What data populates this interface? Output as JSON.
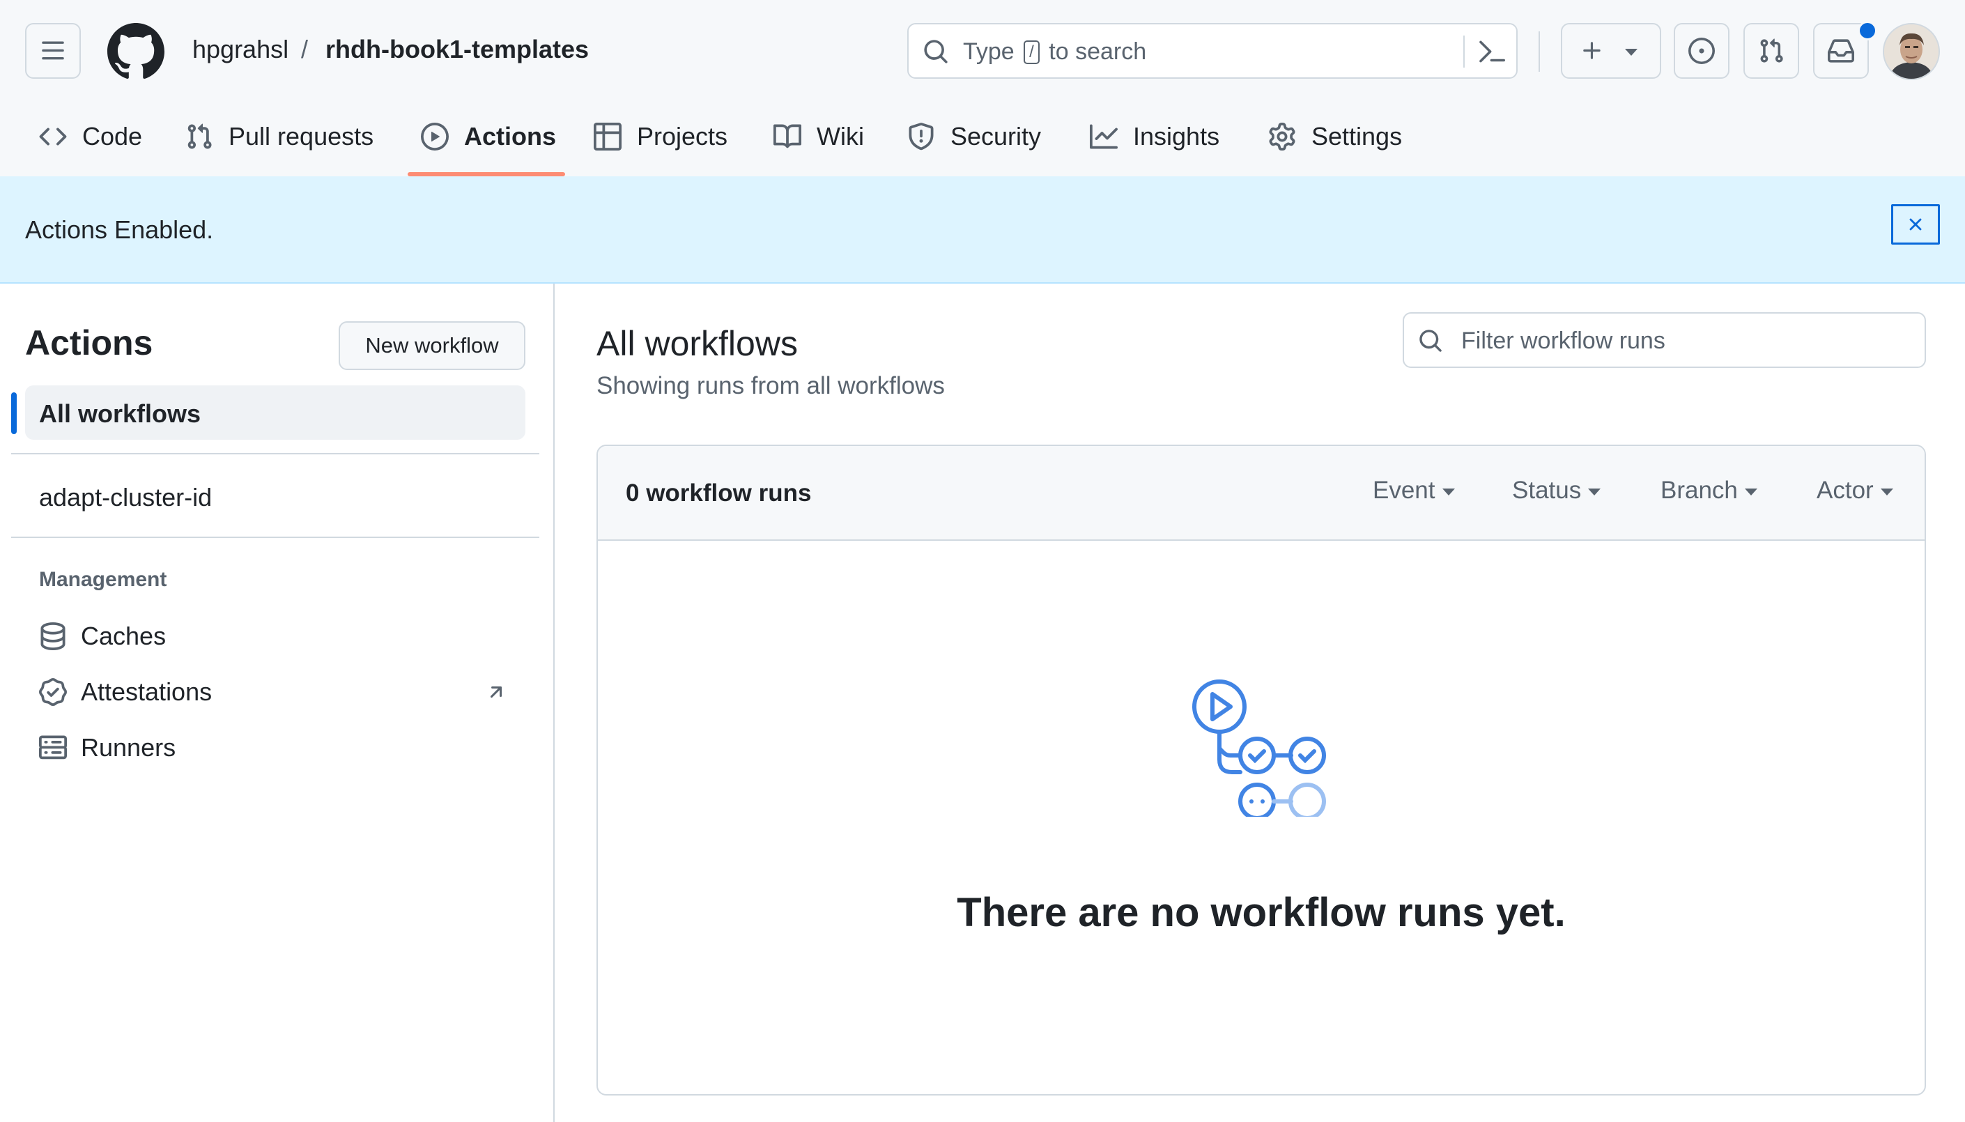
{
  "header": {
    "owner": "hpgrahsl",
    "separator": "/",
    "repo": "rhdh-book1-templates",
    "search": {
      "prefix": "Type",
      "key": "/",
      "suffix": "to search"
    }
  },
  "tabs": [
    {
      "label": "Code",
      "icon": "code-icon"
    },
    {
      "label": "Pull requests",
      "icon": "git-pull-request-icon"
    },
    {
      "label": "Actions",
      "icon": "play-icon",
      "active": true
    },
    {
      "label": "Projects",
      "icon": "table-icon"
    },
    {
      "label": "Wiki",
      "icon": "book-icon"
    },
    {
      "label": "Security",
      "icon": "shield-icon"
    },
    {
      "label": "Insights",
      "icon": "graph-icon"
    },
    {
      "label": "Settings",
      "icon": "gear-icon"
    }
  ],
  "flash": {
    "message": "Actions Enabled."
  },
  "sidebar": {
    "title": "Actions",
    "new_workflow": "New workflow",
    "items": [
      {
        "label": "All workflows",
        "selected": true
      },
      {
        "label": "adapt-cluster-id"
      }
    ],
    "management_heading": "Management",
    "management": [
      {
        "label": "Caches",
        "icon": "database-icon"
      },
      {
        "label": "Attestations",
        "icon": "verified-icon"
      },
      {
        "label": "Runners",
        "icon": "server-icon"
      }
    ]
  },
  "main": {
    "title": "All workflows",
    "subtitle": "Showing runs from all workflows",
    "filter_placeholder": "Filter workflow runs",
    "runs_count": "0 workflow runs",
    "filters": [
      "Event",
      "Status",
      "Branch",
      "Actor"
    ],
    "empty_message": "There are no workflow runs yet."
  },
  "colors": {
    "accent": "#0969da",
    "tab_underline": "#fd8c73",
    "flash_bg": "#ddf4ff",
    "empty_art": "#4184e4"
  }
}
